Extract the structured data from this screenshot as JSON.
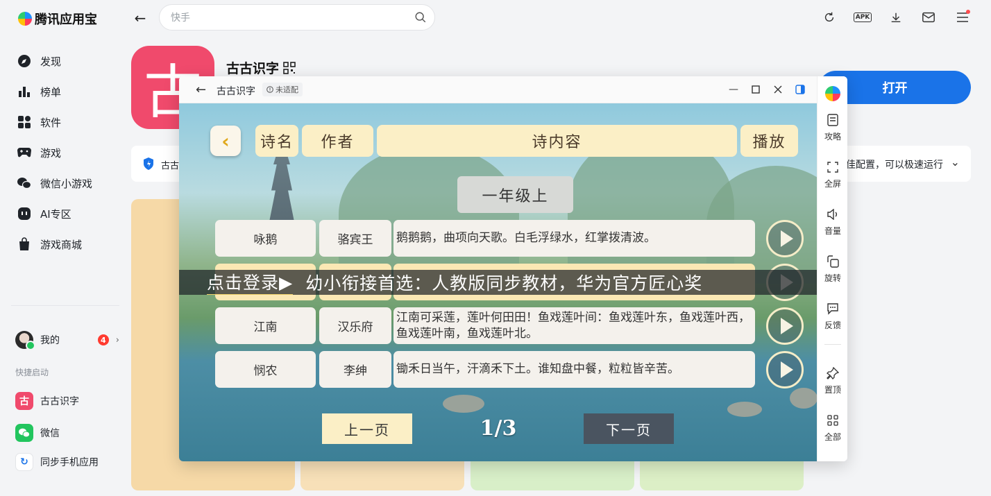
{
  "app": {
    "name": "腾讯应用宝"
  },
  "search": {
    "placeholder": "快手"
  },
  "sidebar": {
    "items": [
      {
        "label": "发现",
        "icon": "compass-icon"
      },
      {
        "label": "榜单",
        "icon": "bar-chart-icon"
      },
      {
        "label": "软件",
        "icon": "grid-icon"
      },
      {
        "label": "游戏",
        "icon": "gamepad-icon"
      },
      {
        "label": "微信小游戏",
        "icon": "wechat-icon"
      },
      {
        "label": "AI专区",
        "icon": "ai-icon"
      },
      {
        "label": "游戏商城",
        "icon": "shopping-bag-icon"
      }
    ],
    "me": {
      "label": "我的",
      "badge": "4"
    },
    "quick_title": "快捷启动",
    "quick_items": [
      {
        "label": "古古识字",
        "icon_char": "古",
        "color": "#f04a6c"
      },
      {
        "label": "微信",
        "icon_char": "微",
        "color": "#22c55e"
      },
      {
        "label": "同步手机应用",
        "icon_char": "↻",
        "color": "#ffffff"
      }
    ]
  },
  "detail": {
    "app_name": "古古识字",
    "app_icon_char": "古",
    "open_label": "打开",
    "info_left": "古古",
    "info_right": "佳配置，可以极速运行"
  },
  "popup": {
    "title": "古古识字",
    "tag": "未适配",
    "header": {
      "name": "诗名",
      "author": "作者",
      "content": "诗内容",
      "play": "播放"
    },
    "grade": "一年级上",
    "rows": [
      {
        "name": "咏鹅",
        "author": "骆宾王",
        "content": "鹅鹅鹅，曲项向天歌。白毛浮绿水，红掌拨清波。"
      },
      {
        "name": "",
        "author": "",
        "content": ""
      },
      {
        "name": "江南",
        "author": "汉乐府",
        "content": "江南可采莲，莲叶何田田！鱼戏莲叶间：鱼戏莲叶东，鱼戏莲叶西，鱼戏莲叶南，鱼戏莲叶北。"
      },
      {
        "name": "悯农",
        "author": "李绅",
        "content": "锄禾日当午，汗滴禾下土。谁知盘中餐，粒粒皆辛苦。"
      }
    ],
    "banner": {
      "lead": "点击登录▶",
      "text": "幼小衔接首选：人教版同步教材，华为官方匠心奖"
    },
    "pager": {
      "prev": "上一页",
      "page": "1/3",
      "next": "下一页"
    },
    "tools": [
      "攻略",
      "全屏",
      "音量",
      "旋转",
      "反馈",
      "置顶",
      "全部"
    ]
  }
}
